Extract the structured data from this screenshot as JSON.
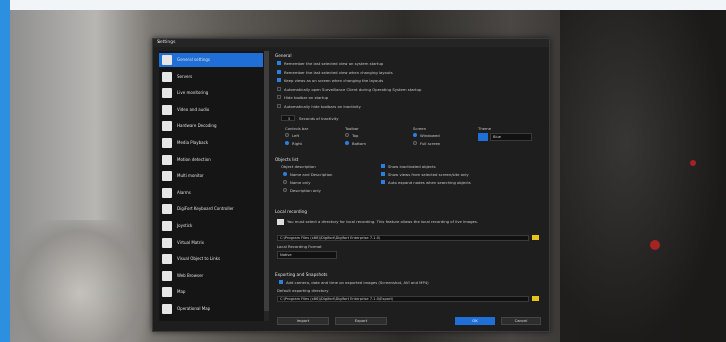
{
  "dialog": {
    "title": "Settings",
    "close_glyph": "×"
  },
  "sidebar": {
    "items": [
      {
        "label": "General settings",
        "icon": "gear-icon",
        "active": true
      },
      {
        "label": "Servers",
        "icon": "server-icon"
      },
      {
        "label": "Live monitoring",
        "icon": "monitor-icon"
      },
      {
        "label": "Video and audio",
        "icon": "video-icon"
      },
      {
        "label": "Hardware Decoding",
        "icon": "chip-icon"
      },
      {
        "label": "Media Playback",
        "icon": "playback-icon"
      },
      {
        "label": "Motion detection",
        "icon": "motion-icon"
      },
      {
        "label": "Multi monitor",
        "icon": "multi-monitor-icon"
      },
      {
        "label": "Alarms",
        "icon": "alarm-icon"
      },
      {
        "label": "DigiFort Keyboard Controller",
        "icon": "keyboard-icon"
      },
      {
        "label": "Joystick",
        "icon": "joystick-icon"
      },
      {
        "label": "Virtual Matrix",
        "icon": "matrix-icon"
      },
      {
        "label": "Visual Object to Links",
        "icon": "link-icon"
      },
      {
        "label": "Web Browser",
        "icon": "browser-icon"
      },
      {
        "label": "Map",
        "icon": "map-icon"
      },
      {
        "label": "Operational Map",
        "icon": "operational-map-icon"
      }
    ]
  },
  "general": {
    "heading": "General",
    "options": [
      {
        "label": "Remember the last selected view on system startup",
        "checked": true
      },
      {
        "label": "Remember the last selected view when changing layouts",
        "checked": true
      },
      {
        "label": "Keep views as on screen when changing the layouts",
        "checked": true
      },
      {
        "label": "Automatically open Surveillance Client during Operating System startup",
        "checked": false
      },
      {
        "label": "Hide toolbar on startup",
        "checked": false
      },
      {
        "label": "Automatically hide toolbars on Inactivity",
        "checked": false
      }
    ],
    "inactivity_value": "5",
    "inactivity_label": "Seconds of inactivity"
  },
  "layout_groups": {
    "controls_bar": {
      "title": "Controls bar",
      "options": [
        "Left",
        "Right"
      ],
      "selected": "Right"
    },
    "toolbar": {
      "title": "Toolbar",
      "options": [
        "Top",
        "Bottom"
      ],
      "selected": "Bottom"
    },
    "screen": {
      "title": "Screen",
      "options": [
        "Windowed",
        "Full screen"
      ],
      "selected": "Windowed"
    },
    "theme": {
      "title": "Theme",
      "value": "Blue",
      "color": "#1f6fd6"
    }
  },
  "objects_list": {
    "heading": "Objects list",
    "description_title": "Object description",
    "description_options": [
      "Name and Description",
      "Name only",
      "Description only"
    ],
    "description_selected": "Name and Description",
    "right_options": [
      {
        "label": "Show inactivated objects",
        "checked": true
      },
      {
        "label": "Show views from selected screen/site only",
        "checked": true
      },
      {
        "label": "Auto expand nodes when searching objects",
        "checked": true
      }
    ]
  },
  "local_recording": {
    "heading": "Local recording",
    "notice": "You must select a directory for local recording. This feature allows the local recording of live images.",
    "path": "C:\\Program Files (x86)\\Digifort\\Digifort Enterprise 7.1.0\\",
    "format_label": "Local Recording Format",
    "format_value": "Native"
  },
  "exporting": {
    "heading": "Exporting and Snapshots",
    "option": {
      "label": "Add camera, date and time on exported images (Screenshot, AVI and MP4)",
      "checked": true
    },
    "dir_label": "Default exporting directory",
    "dir_path": "C:\\Program Files (x86)\\Digifort\\Digifort Enterprise 7.1.0\\Export\\"
  },
  "footer": {
    "import": "Import",
    "export": "Export",
    "ok": "OK",
    "cancel": "Cancel"
  }
}
